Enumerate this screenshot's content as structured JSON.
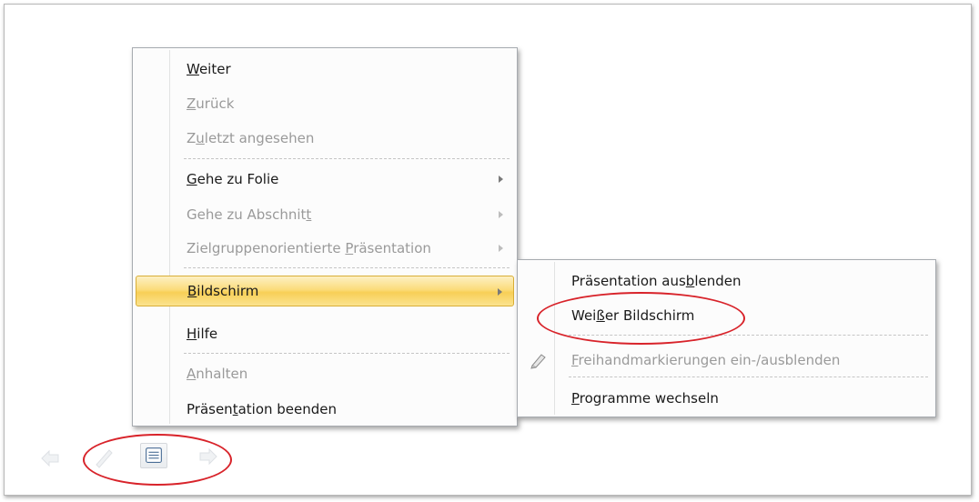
{
  "context_menu": {
    "items": [
      {
        "pre": "",
        "mn": "W",
        "post": "eiter",
        "disabled": false
      },
      {
        "pre": "",
        "mn": "Z",
        "post": "urück",
        "disabled": true
      },
      {
        "pre": "Z",
        "mn": "u",
        "post": "letzt angesehen",
        "disabled": true
      },
      {
        "pre": "",
        "mn": "G",
        "post": "ehe zu Folie",
        "disabled": false,
        "submenu": true
      },
      {
        "pre": "Gehe zu Abschnit",
        "mn": "t",
        "post": "",
        "disabled": true,
        "submenu": true
      },
      {
        "pre": "Zielgruppenorientierte ",
        "mn": "P",
        "post": "räsentation",
        "disabled": true,
        "submenu": true
      },
      {
        "pre": "",
        "mn": "B",
        "post": "ildschirm",
        "disabled": false,
        "submenu": true,
        "highlighted": true
      },
      {
        "pre": "",
        "mn": "H",
        "post": "ilfe",
        "disabled": false
      },
      {
        "pre": "",
        "mn": "A",
        "post": "nhalten",
        "disabled": true
      },
      {
        "pre": "Präsen",
        "mn": "t",
        "post": "ation beenden",
        "disabled": false
      }
    ]
  },
  "submenu": {
    "items": [
      {
        "pre": "Präsentation aus",
        "mn": "b",
        "post": "lenden",
        "disabled": false
      },
      {
        "pre": "Wei",
        "mn": "ß",
        "post": "er Bildschirm",
        "disabled": false
      },
      {
        "pre": "",
        "mn": "F",
        "post": "reihandmarkierungen ein-/ausblenden",
        "disabled": true,
        "icon": "pen-icon"
      },
      {
        "pre": "",
        "mn": "P",
        "post": "rogramme wechseln",
        "disabled": false
      }
    ]
  },
  "toolbar": {
    "buttons": [
      {
        "name": "previous-arrow-icon",
        "state": "disabled"
      },
      {
        "name": "pen-icon",
        "state": "disabled"
      },
      {
        "name": "menu-icon",
        "state": "active"
      },
      {
        "name": "next-arrow-icon",
        "state": "disabled"
      }
    ]
  },
  "colors": {
    "highlight": "#f8cf56",
    "annotation_oval": "#d8232a",
    "disabled_text": "#9a9a9a"
  }
}
